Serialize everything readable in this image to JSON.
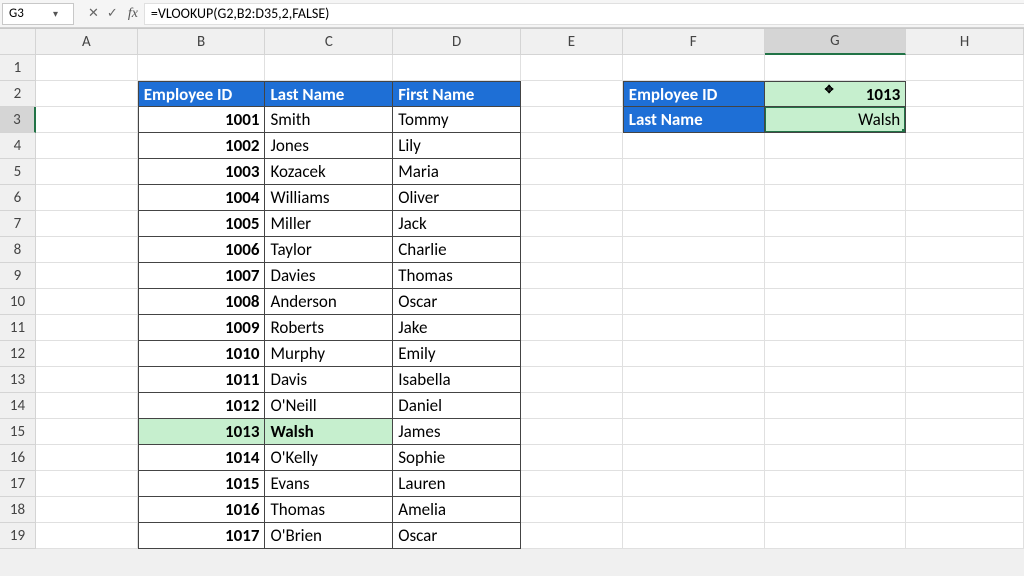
{
  "namebox": "G3",
  "formula": "=VLOOKUP(G2,B2:D35,2,FALSE)",
  "columns": [
    "A",
    "B",
    "C",
    "D",
    "E",
    "F",
    "G",
    "H"
  ],
  "row_count": 19,
  "selected": {
    "col": "G",
    "row": 3
  },
  "table": {
    "headers": {
      "b": "Employee ID",
      "c": "Last Name",
      "d": "First Name"
    },
    "rows": [
      {
        "id": "1001",
        "last": "Smith",
        "first": "Tommy"
      },
      {
        "id": "1002",
        "last": "Jones",
        "first": "Lily"
      },
      {
        "id": "1003",
        "last": "Kozacek",
        "first": "Maria"
      },
      {
        "id": "1004",
        "last": "Williams",
        "first": "Oliver"
      },
      {
        "id": "1005",
        "last": "Miller",
        "first": "Jack"
      },
      {
        "id": "1006",
        "last": "Taylor",
        "first": "Charlie"
      },
      {
        "id": "1007",
        "last": "Davies",
        "first": "Thomas"
      },
      {
        "id": "1008",
        "last": "Anderson",
        "first": "Oscar"
      },
      {
        "id": "1009",
        "last": "Roberts",
        "first": "Jake"
      },
      {
        "id": "1010",
        "last": "Murphy",
        "first": "Emily"
      },
      {
        "id": "1011",
        "last": "Davis",
        "first": "Isabella"
      },
      {
        "id": "1012",
        "last": "O'Neill",
        "first": "Daniel"
      },
      {
        "id": "1013",
        "last": "Walsh",
        "first": "James"
      },
      {
        "id": "1014",
        "last": "O'Kelly",
        "first": "Sophie"
      },
      {
        "id": "1015",
        "last": "Evans",
        "first": "Lauren"
      },
      {
        "id": "1016",
        "last": "Thomas",
        "first": "Amelia"
      },
      {
        "id": "1017",
        "last": "O'Brien",
        "first": "Oscar"
      }
    ],
    "highlight_row_index": 12
  },
  "lookup": {
    "label_id": "Employee ID",
    "label_last": "Last Name",
    "id_value": "1013",
    "result": "Walsh"
  },
  "icons": {
    "cancel": "✕",
    "confirm": "✓",
    "dropdown": "▾",
    "fx": "fx",
    "move": "✥"
  }
}
